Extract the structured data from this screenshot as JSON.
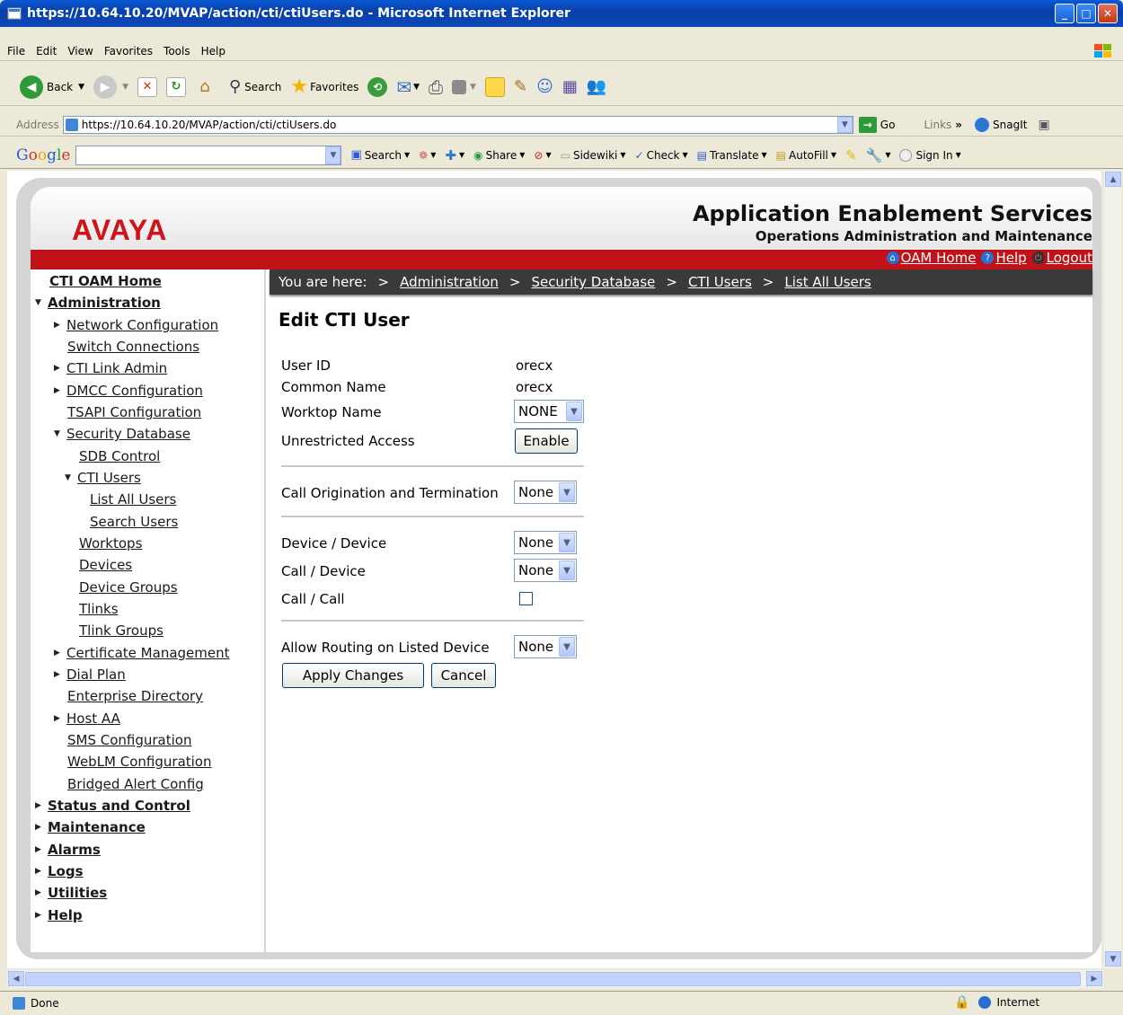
{
  "window": {
    "title": "https://10.64.10.20/MVAP/action/cti/ctiUsers.do - Microsoft Internet Explorer"
  },
  "menu": [
    "File",
    "Edit",
    "View",
    "Favorites",
    "Tools",
    "Help"
  ],
  "toolbar": {
    "back": "Back",
    "search": "Search",
    "favorites": "Favorites"
  },
  "address": {
    "label": "Address",
    "url": "https://10.64.10.20/MVAP/action/cti/ctiUsers.do",
    "go": "Go",
    "links": "Links",
    "snagit": "SnagIt"
  },
  "google": {
    "logo": "Google",
    "search": "Search",
    "share": "Share",
    "sidewiki": "Sidewiki",
    "check": "Check",
    "translate": "Translate",
    "autofill": "AutoFill",
    "signin": "Sign In"
  },
  "header": {
    "logo": "AVAYA",
    "app_title": "Application Enablement Services",
    "app_subtitle": "Operations Administration and Maintenance",
    "oam_home": "OAM Home",
    "help": "Help",
    "logout": "Logout"
  },
  "breadcrumb": {
    "prefix": "You are here:",
    "items": [
      "Administration",
      "Security Database",
      "CTI Users",
      "List All Users"
    ]
  },
  "nav": {
    "cti_oam_home": "CTI OAM Home",
    "administration": "Administration",
    "network_configuration": "Network Configuration",
    "switch_connections": "Switch Connections",
    "cti_link_admin": "CTI Link Admin",
    "dmcc_configuration": "DMCC Configuration",
    "tsapi_configuration": "TSAPI Configuration",
    "security_database": "Security Database",
    "sdb_control": "SDB Control",
    "cti_users": "CTI Users",
    "list_all_users": "List All Users",
    "search_users": "Search Users",
    "worktops": "Worktops",
    "devices": "Devices",
    "device_groups": "Device Groups",
    "tlinks": "Tlinks",
    "tlink_groups": "Tlink Groups",
    "certificate_management": "Certificate Management",
    "dial_plan": "Dial Plan",
    "enterprise_directory": "Enterprise Directory",
    "host_aa": "Host AA",
    "sms_configuration": "SMS Configuration",
    "weblm_configuration": "WebLM Configuration",
    "bridged_alert_config": "Bridged Alert Config",
    "status_and_control": "Status and Control",
    "maintenance": "Maintenance",
    "alarms": "Alarms",
    "logs": "Logs",
    "utilities": "Utilities",
    "help": "Help"
  },
  "form": {
    "title": "Edit CTI User",
    "user_id_label": "User ID",
    "user_id_value": "orecx",
    "common_name_label": "Common Name",
    "common_name_value": "orecx",
    "worktop_name_label": "Worktop Name",
    "worktop_name_value": "NONE",
    "unrestricted_access_label": "Unrestricted Access",
    "unrestricted_access_button": "Enable",
    "call_orig_term_label": "Call Origination and Termination",
    "call_orig_term_value": "None",
    "device_device_label": "Device / Device",
    "device_device_value": "None",
    "call_device_label": "Call / Device",
    "call_device_value": "None",
    "call_call_label": "Call / Call",
    "call_call_checked": false,
    "allow_routing_label": "Allow Routing on Listed Device",
    "allow_routing_value": "None",
    "apply_button": "Apply Changes",
    "cancel_button": "Cancel"
  },
  "status": {
    "text": "Done",
    "zone": "Internet"
  }
}
